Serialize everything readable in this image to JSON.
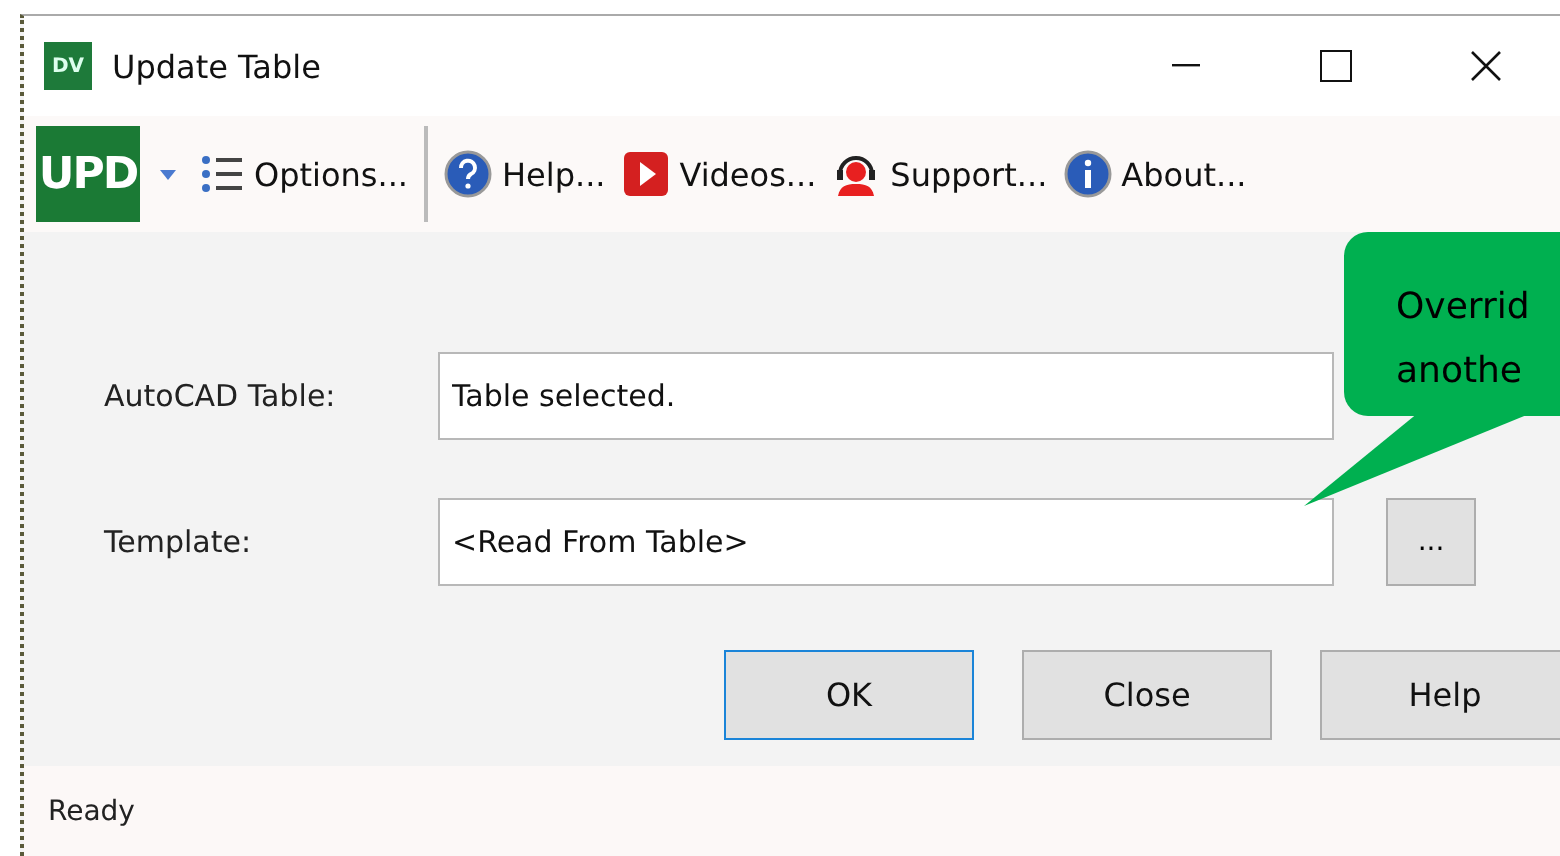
{
  "window": {
    "title": "Update Table",
    "app_icon": "DV"
  },
  "toolbar": {
    "logo": "UPD",
    "items": [
      {
        "kind": "options",
        "label": "Options..."
      },
      {
        "kind": "help",
        "label": "Help..."
      },
      {
        "kind": "videos",
        "label": "Videos..."
      },
      {
        "kind": "support",
        "label": "Support..."
      },
      {
        "kind": "about",
        "label": "About..."
      }
    ]
  },
  "fields": [
    {
      "label": "AutoCAD Table:",
      "value": "Table selected."
    },
    {
      "label": "Template:",
      "value": "<Read From Table>",
      "browse": "..."
    }
  ],
  "buttons": [
    {
      "label": "OK",
      "focused": true
    },
    {
      "label": "Close",
      "focused": false
    },
    {
      "label": "Help",
      "focused": false
    }
  ],
  "callout": {
    "lines": [
      "Overrid",
      "anothe"
    ]
  },
  "status_bar": "Ready"
}
